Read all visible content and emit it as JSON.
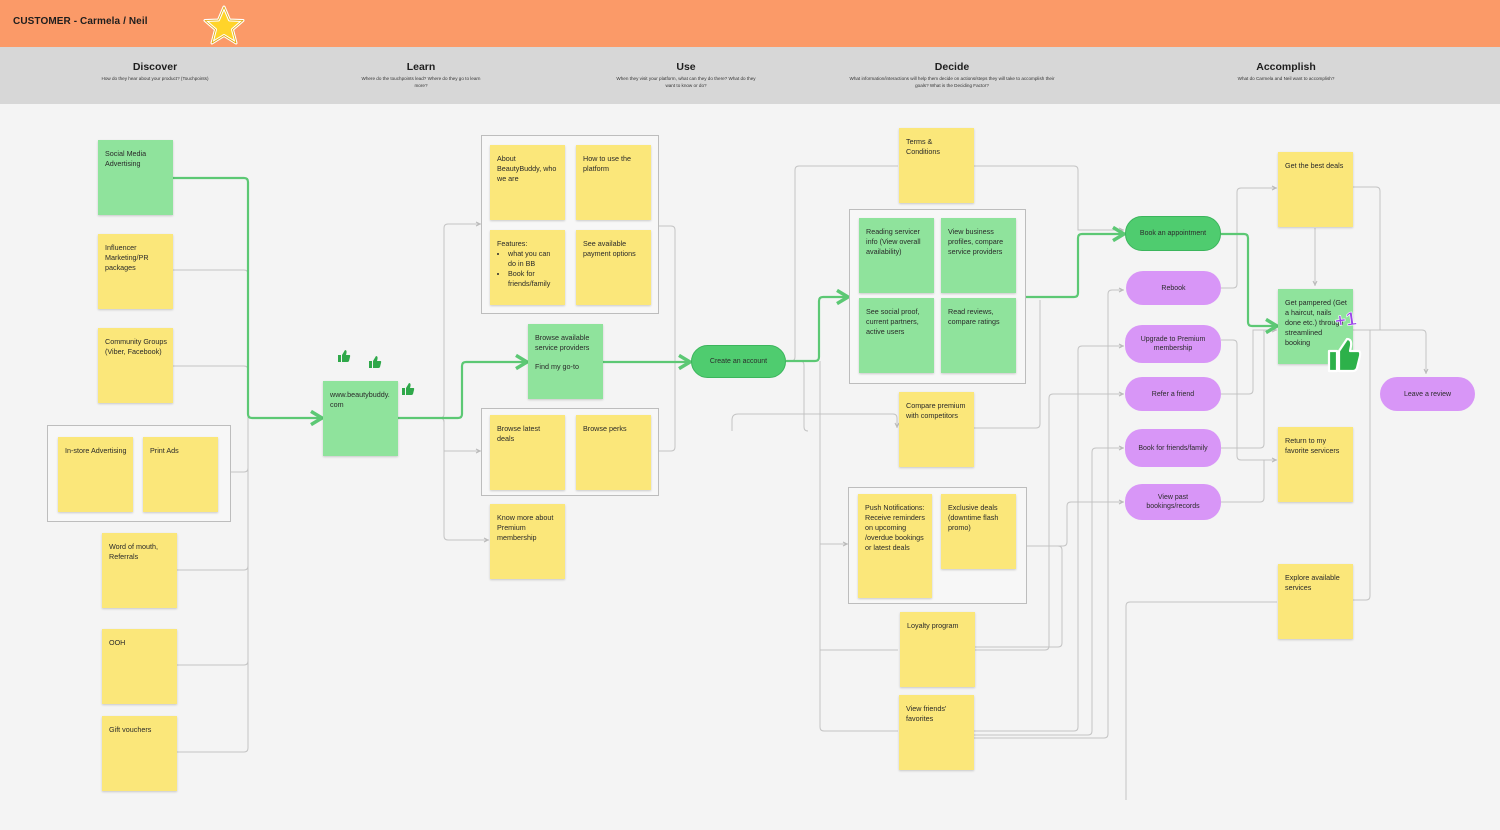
{
  "header": {
    "title": "CUSTOMER - Carmela / Neil",
    "star_icon": "star-icon",
    "colors": {
      "banner": "#fb9a68",
      "phase_bar": "#d7d7d7",
      "connector": "#5cc874"
    }
  },
  "phases": [
    {
      "title": "Discover",
      "desc": "How do they hear about your product? (Touchpoints)"
    },
    {
      "title": "Learn",
      "desc": "Where do the touchpoints lead? Where do they go to learn more?"
    },
    {
      "title": "Use",
      "desc": "When they visit your platform, what can they do there? What do they want to know or do?"
    },
    {
      "title": "Decide",
      "desc": "What information/interactions will help them decide on actions/steps they will take to accomplish their goals? What is the Deciding Factor?"
    },
    {
      "title": "Accomplish",
      "desc": "What do Carmela and Neil want to accomplish?"
    }
  ],
  "discover": {
    "social": "Social Media Advertising",
    "influencer": "Influencer Marketing/PR packages",
    "community": "Community Groups (Viber, Facebook)",
    "instore": "In-store Advertising",
    "print": "Print Ads",
    "wom": "Word of mouth, Referrals",
    "ooh": "OOH",
    "gift": "Gift vouchers"
  },
  "learn": {
    "website": "www.beautybuddy.com",
    "about": "About BeautyBuddy, who we are",
    "howto": "How to use the platform",
    "features_title": "Features:",
    "features_items": [
      "what you can do in BB",
      "Book for friends/family"
    ],
    "payment": "See available payment options",
    "browse_deals": "Browse latest deals",
    "browse_perks": "Browse perks",
    "premium": "Know more about Premium membership"
  },
  "use": {
    "browse_providers": "Browse available service providers",
    "find_goto": "Find my go-to",
    "create_account": "Create an account"
  },
  "decide": {
    "terms": "Terms & Conditions",
    "reading_info": "Reading servicer info (View overall availability)",
    "view_profiles": "View business profiles, compare service providers",
    "social_proof": "See social proof, current partners, active users",
    "read_reviews": "Read reviews, compare ratings",
    "compare_premium": "Compare premium with competitors",
    "push": "Push Notifications: Receive reminders on upcoming /overdue bookings or latest deals",
    "exclusive": "Exclusive deals (downtime flash promo)",
    "loyalty": "Loyalty program",
    "friends_fav": "View friends' favorites"
  },
  "actions": {
    "book": "Book an appointment",
    "rebook": "Rebook",
    "upgrade": "Upgrade to Premium membership",
    "refer": "Refer a friend",
    "book_friends": "Book for friends/family",
    "view_past": "View past bookings/records"
  },
  "accomplish": {
    "best_deals": "Get the best deals",
    "pampered": "Get pampered (Get a haircut, nails done etc.) through streamlined booking",
    "return": "Return to my favorite servicers",
    "explore": "Explore available services",
    "review": "Leave a review",
    "plus_one": "+1"
  }
}
